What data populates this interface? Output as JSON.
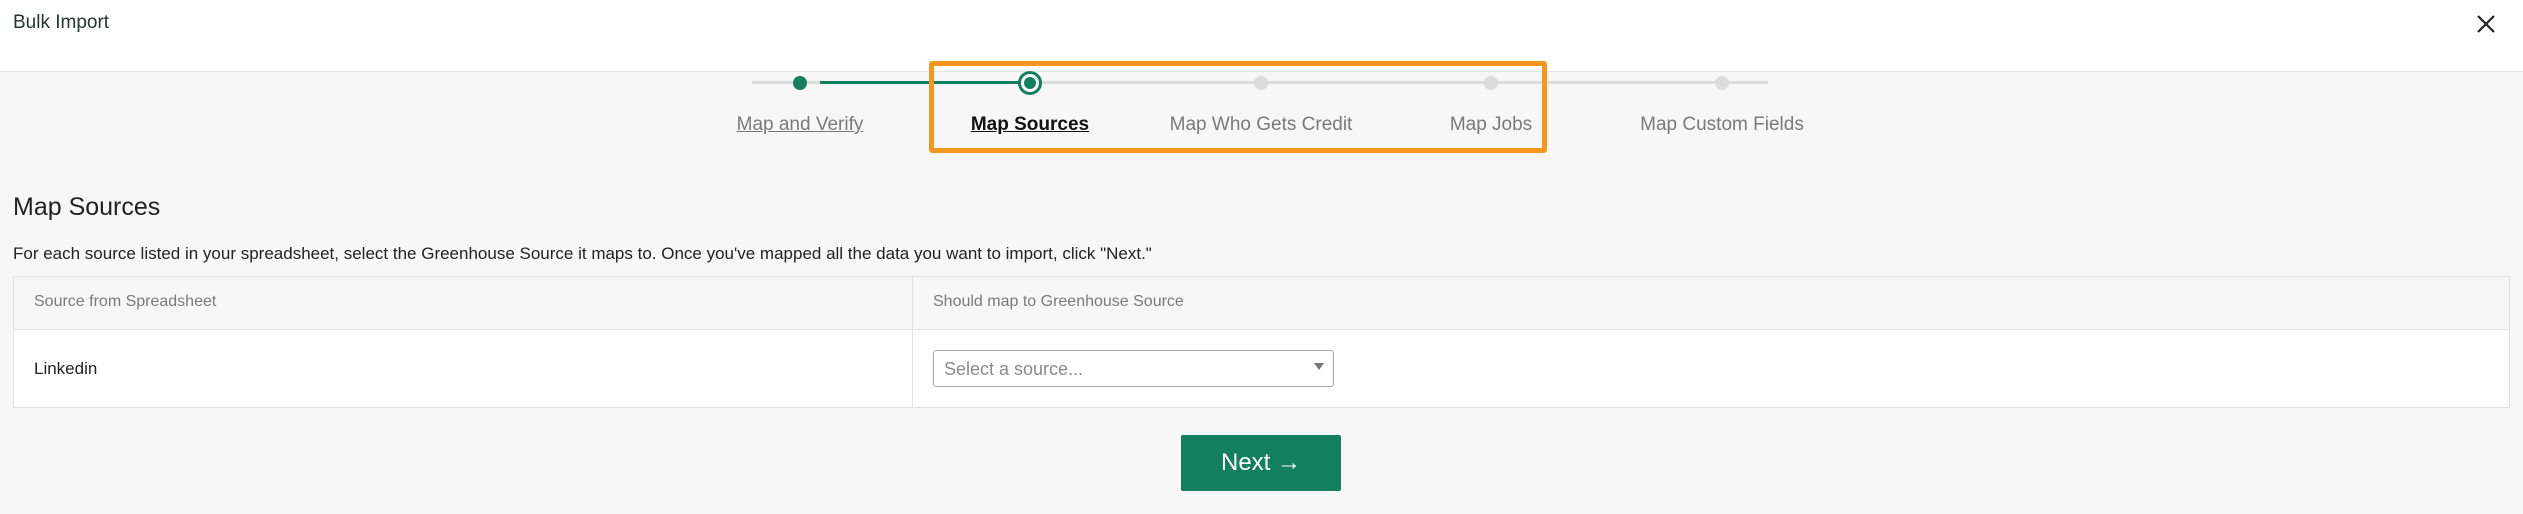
{
  "header": {
    "title": "Bulk Import",
    "close_icon": "close-icon"
  },
  "stepper": {
    "steps": [
      {
        "label": "Map and Verify",
        "state": "done"
      },
      {
        "label": "Map Sources",
        "state": "current"
      },
      {
        "label": "Map Who Gets Credit",
        "state": "upcoming"
      },
      {
        "label": "Map Jobs",
        "state": "upcoming"
      },
      {
        "label": "Map Custom Fields",
        "state": "upcoming"
      }
    ],
    "highlight_color": "#f5961e"
  },
  "main": {
    "title": "Map Sources",
    "instructions": "For each source listed in your spreadsheet, select the Greenhouse Source it maps to. Once you've mapped all the data you want to import, click \"Next.\"",
    "table": {
      "headers": [
        "Source from Spreadsheet",
        "Should map to Greenhouse Source"
      ],
      "rows": [
        {
          "source": "Linkedin",
          "select_placeholder": "Select a source..."
        }
      ]
    },
    "next_label": "Next →"
  },
  "colors": {
    "accent": "#12805c",
    "background": "#f7f7f7"
  }
}
